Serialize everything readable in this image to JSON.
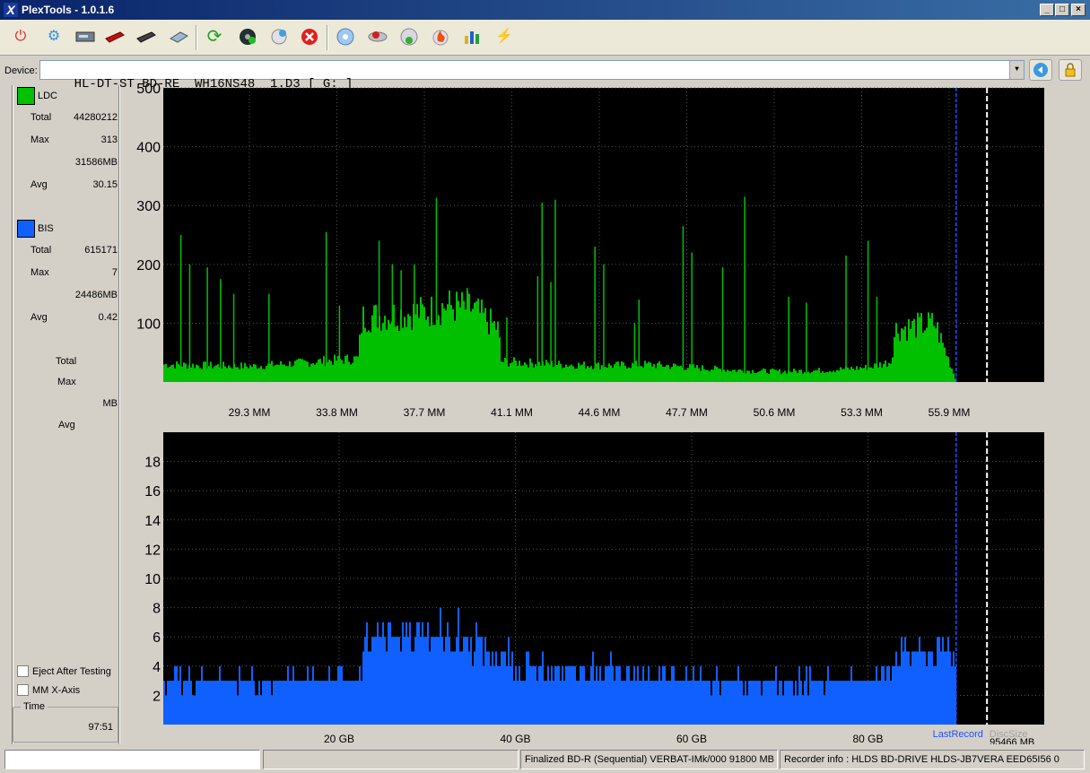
{
  "window": {
    "title": "PlexTools - 1.0.1.6",
    "logo": "X"
  },
  "toolbar": {
    "icons": [
      "power-icon",
      "settings-icon",
      "drive-icon",
      "dvd-icon",
      "bd-icon",
      "scanner-icon",
      "refresh-icon",
      "disc-eject-icon",
      "disc-add-icon",
      "stop-icon",
      "disc-info-icon",
      "burn-icon",
      "network-icon",
      "fire-icon",
      "chart-icon",
      "tool-icon"
    ]
  },
  "device": {
    "label": "Device:",
    "value": "HL-DT-ST BD-RE  WH16NS48  1.D3 [ G: ]"
  },
  "ldc": {
    "name": "LDC",
    "color": "#00c000",
    "total_label": "Total",
    "total": "44280212",
    "max_label": "Max",
    "max": "313",
    "max_pos": "31586MB",
    "avg_label": "Avg",
    "avg": "30.15"
  },
  "bis": {
    "name": "BIS",
    "color": "#1060ff",
    "total_label": "Total",
    "total": "615171",
    "max_label": "Max",
    "max": "7",
    "max_pos": "24486MB",
    "avg_label": "Avg",
    "avg": "0.42"
  },
  "third": {
    "total_label": "Total",
    "max_label": "Max",
    "mb_label": "MB",
    "avg_label": "Avg"
  },
  "options": {
    "eject": "Eject After Testing",
    "mm_axis": "MM X-Axis"
  },
  "time": {
    "label": "Time",
    "value": "97:51"
  },
  "status": {
    "input": "",
    "disc": "Finalized   BD-R (Sequential)   VERBAT-IMk/000   91800 MB",
    "recorder": "Recorder info  : HLDS BD-DRIVE   HLDS-JB7VERA    EED65I56 0"
  },
  "chart_data": [
    {
      "type": "area",
      "series": [
        {
          "name": "LDC",
          "color": "#00c000"
        }
      ],
      "ylim": [
        0,
        500
      ],
      "yticks": [
        "100",
        "200",
        "300",
        "400",
        "500"
      ],
      "xticks": [
        "29.3 MM",
        "33.8 MM",
        "37.7 MM",
        "41.1 MM",
        "44.6 MM",
        "47.7 MM",
        "50.6 MM",
        "53.3 MM",
        "55.9 MM"
      ],
      "grid": true,
      "profile": [
        [
          0,
          30
        ],
        [
          0.05,
          28
        ],
        [
          0.1,
          27
        ],
        [
          0.15,
          32
        ],
        [
          0.2,
          38
        ],
        [
          0.22,
          40
        ],
        [
          0.225,
          110
        ],
        [
          0.3,
          120
        ],
        [
          0.32,
          130
        ],
        [
          0.35,
          125
        ],
        [
          0.38,
          90
        ],
        [
          0.382,
          35
        ],
        [
          0.45,
          30
        ],
        [
          0.5,
          28
        ],
        [
          0.55,
          30
        ],
        [
          0.6,
          25
        ],
        [
          0.65,
          20
        ],
        [
          0.7,
          18
        ],
        [
          0.75,
          20
        ],
        [
          0.8,
          25
        ],
        [
          0.825,
          35
        ],
        [
          0.83,
          90
        ],
        [
          0.875,
          100
        ],
        [
          0.9,
          0
        ]
      ],
      "spikes": [
        [
          0.02,
          250
        ],
        [
          0.03,
          200
        ],
        [
          0.05,
          195
        ],
        [
          0.065,
          175
        ],
        [
          0.08,
          150
        ],
        [
          0.12,
          150
        ],
        [
          0.185,
          255
        ],
        [
          0.2,
          130
        ],
        [
          0.245,
          240
        ],
        [
          0.26,
          200
        ],
        [
          0.27,
          190
        ],
        [
          0.285,
          200
        ],
        [
          0.31,
          313
        ],
        [
          0.345,
          160
        ],
        [
          0.39,
          110
        ],
        [
          0.425,
          180
        ],
        [
          0.44,
          170
        ],
        [
          0.43,
          305
        ],
        [
          0.445,
          310
        ],
        [
          0.49,
          230
        ],
        [
          0.5,
          200
        ],
        [
          0.535,
          100
        ],
        [
          0.54,
          140
        ],
        [
          0.59,
          265
        ],
        [
          0.6,
          220
        ],
        [
          0.635,
          195
        ],
        [
          0.66,
          315
        ],
        [
          0.71,
          145
        ],
        [
          0.73,
          135
        ],
        [
          0.775,
          215
        ],
        [
          0.8,
          240
        ],
        [
          0.81,
          145
        ]
      ],
      "last_record_frac": 0.9,
      "end_frac": 0.935
    },
    {
      "type": "bar",
      "series": [
        {
          "name": "BIS",
          "color": "#1060ff"
        }
      ],
      "ylim": [
        0,
        20
      ],
      "yticks": [
        "2",
        "4",
        "6",
        "8",
        "10",
        "12",
        "14",
        "16",
        "18"
      ],
      "xticks": [
        "20 GB",
        "40 GB",
        "60 GB",
        "80 GB"
      ],
      "grid": true,
      "profile": [
        [
          0,
          3
        ],
        [
          0.22,
          3
        ],
        [
          0.225,
          4
        ],
        [
          0.225,
          6
        ],
        [
          0.28,
          6
        ],
        [
          0.3,
          6.5
        ],
        [
          0.35,
          5.5
        ],
        [
          0.4,
          4
        ],
        [
          0.6,
          3
        ],
        [
          0.8,
          3
        ],
        [
          0.825,
          4
        ],
        [
          0.83,
          5
        ],
        [
          0.9,
          5
        ]
      ],
      "labels": {
        "last_record": "LastRecord",
        "disc_size": "DiscSize",
        "end_value": "95466 MB"
      },
      "last_record_frac": 0.9,
      "end_frac": 0.935
    }
  ]
}
